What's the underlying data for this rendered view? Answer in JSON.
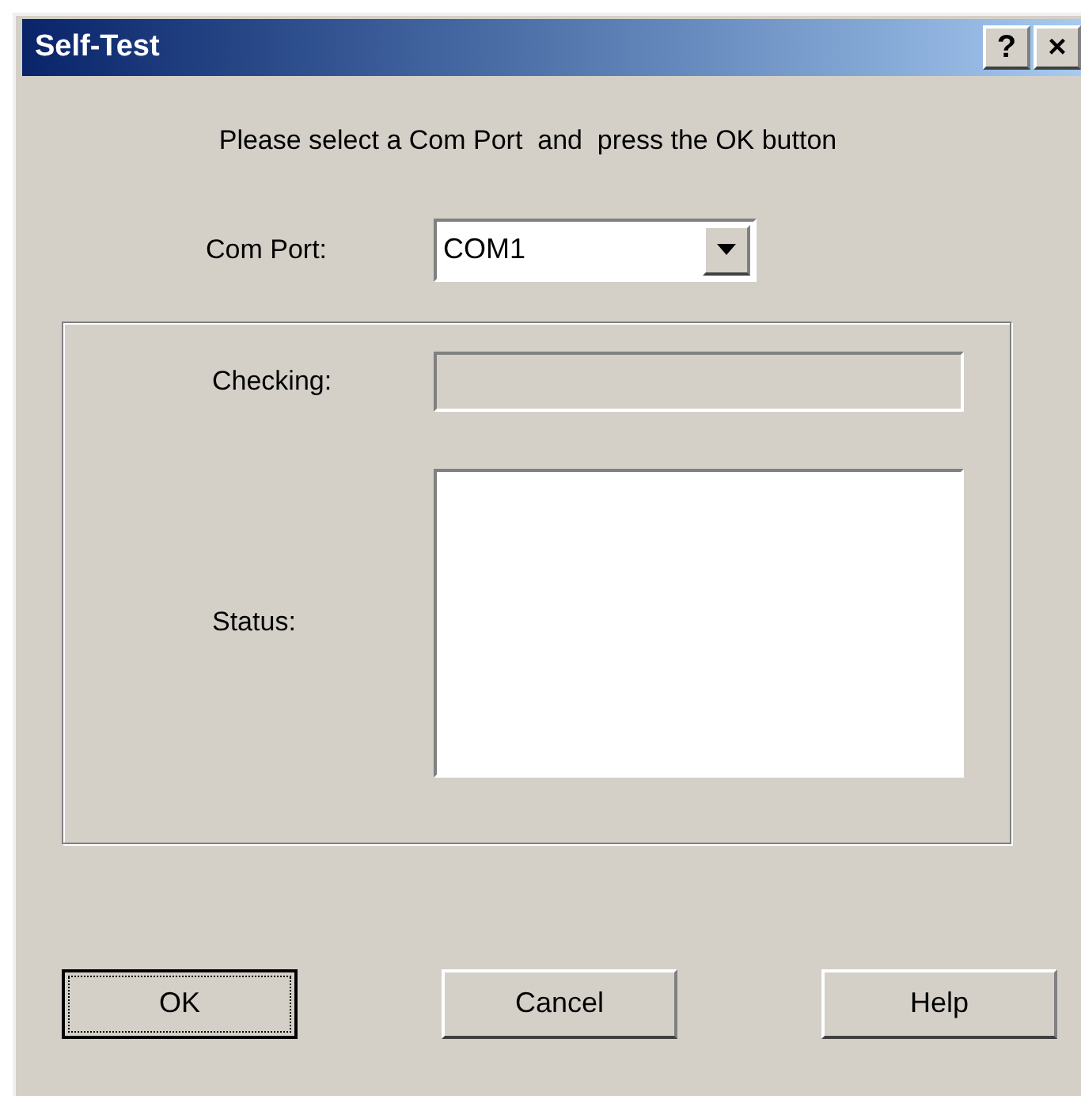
{
  "window": {
    "title": "Self-Test",
    "title_buttons": [
      "?",
      "×"
    ]
  },
  "instruction": "Please select a Com Port  and  press the OK button",
  "com_port": {
    "label": "Com Port:",
    "value": "COM1"
  },
  "checking": {
    "label": "Checking:",
    "disabled": true
  },
  "status": {
    "label": "Status:"
  },
  "buttons": [
    {
      "label": "OK",
      "default": true
    },
    {
      "label": "Cancel",
      "default": false
    },
    {
      "label": "Help",
      "default": false
    }
  ]
}
